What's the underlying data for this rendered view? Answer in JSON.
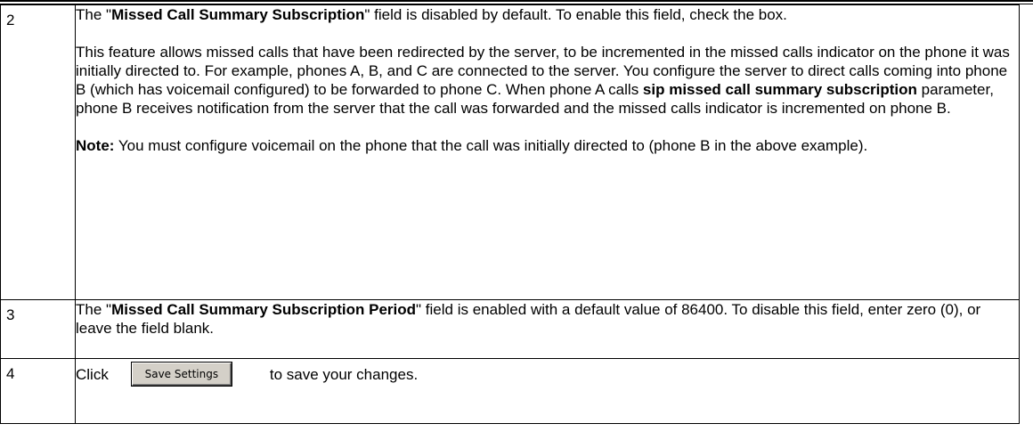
{
  "steps": [
    {
      "number": "2",
      "p1": {
        "before": "The \"",
        "bold": "Missed Call Summary Subscription",
        "after": "\" field is disabled by default. To enable this field, check the box."
      },
      "p2": {
        "before": "This feature allows missed calls that have been redirected by the server, to be incremented in the missed calls indicator on the phone it was initially directed to. For example, phones A, B, and C are connected to the server. You configure the server to direct calls coming into phone B (which has voicemail configured) to be forwarded to phone C. When phone A calls ",
        "bold": "sip missed call summary subscription",
        "after": " parameter, phone B receives notification from the server that the call was forwarded and the missed calls indicator is incremented on phone B."
      },
      "note": {
        "label": "Note:",
        "text": " You must configure voicemail on the phone that the call was initially directed to (phone B in the above example)."
      }
    },
    {
      "number": "3",
      "p1": {
        "before": "The \"",
        "bold": "Missed Call Summary Subscription Period",
        "after": "\" field is enabled with a default value of 86400. To disable this field, enter zero (0), or leave the field blank."
      }
    },
    {
      "number": "4",
      "click_label": "Click",
      "button_label": "Save Settings",
      "after_button": "to save your changes."
    }
  ]
}
